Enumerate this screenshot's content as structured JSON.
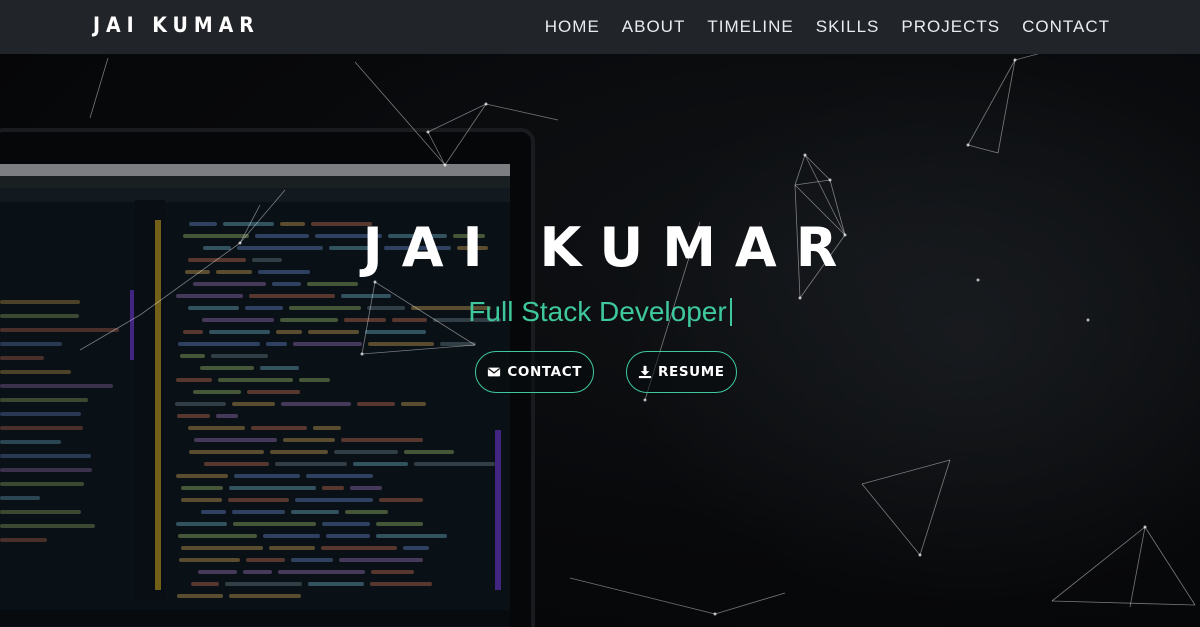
{
  "brand": {
    "name": "JAI KUMAR"
  },
  "nav": {
    "items": [
      "HOME",
      "ABOUT",
      "TIMELINE",
      "SKILLS",
      "PROJECTS",
      "CONTACT"
    ]
  },
  "hero": {
    "title": "JAI KUMAR",
    "subtitle": "Full Stack Developer",
    "buttons": {
      "contact": {
        "label": "CONTACT",
        "icon": "envelope-icon"
      },
      "resume": {
        "label": "RESUME",
        "icon": "download-icon"
      }
    }
  },
  "colors": {
    "accent": "#3ec89b",
    "navbar": "#212429",
    "background": "#0b0d10"
  }
}
